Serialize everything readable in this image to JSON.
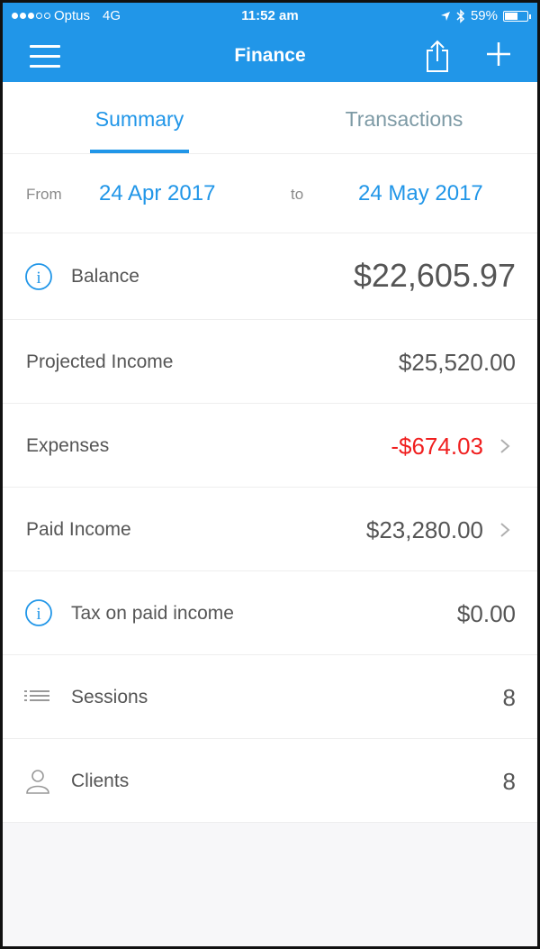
{
  "status_bar": {
    "carrier": "Optus",
    "network": "4G",
    "time": "11:52 am",
    "battery_percent": "59%",
    "battery_level": 0.59
  },
  "header": {
    "title": "Finance",
    "menu_icon": "menu-icon",
    "share_icon": "share-icon",
    "add_icon": "plus-icon"
  },
  "tabs": [
    {
      "label": "Summary",
      "active": true
    },
    {
      "label": "Transactions",
      "active": false
    }
  ],
  "range": {
    "from_label": "From",
    "from_date": "24 Apr 2017",
    "to_label": "to",
    "to_date": "24 May 2017"
  },
  "rows": {
    "balance": {
      "label": "Balance",
      "value": "$22,605.97",
      "icon": "info-icon"
    },
    "projected_income": {
      "label": "Projected Income",
      "value": "$25,520.00"
    },
    "expenses": {
      "label": "Expenses",
      "value": "-$674.03",
      "icon": "chevron-right-icon"
    },
    "paid_income": {
      "label": "Paid Income",
      "value": "$23,280.00",
      "icon": "chevron-right-icon"
    },
    "tax": {
      "label": "Tax on paid income",
      "value": "$0.00",
      "icon": "info-icon"
    },
    "sessions": {
      "label": "Sessions",
      "value": "8",
      "icon": "list-icon"
    },
    "clients": {
      "label": "Clients",
      "value": "8",
      "icon": "person-icon"
    }
  },
  "colors": {
    "accent": "#2196e8",
    "negative": "#f01f1f",
    "text": "#555555",
    "muted": "#8a8a8a"
  }
}
